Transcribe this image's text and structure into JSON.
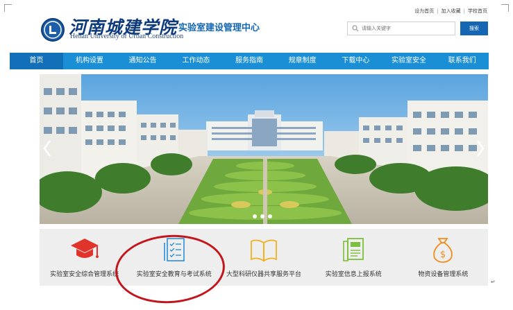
{
  "header": {
    "logo_cn": "河南城建学院",
    "logo_en": "Henan University of Urban Construction",
    "site_title": "实验室建设管理中心",
    "top_links": [
      "设为首页",
      "加入收藏",
      "学校首页"
    ],
    "search": {
      "placeholder": "请输入关键字",
      "button_label": "搜索"
    }
  },
  "nav": {
    "items": [
      "首页",
      "机构设置",
      "通知公告",
      "工作动态",
      "服务指南",
      "规章制度",
      "下载中心",
      "实验室安全",
      "联系我们"
    ],
    "active_index": 0
  },
  "banner": {
    "slide_count": 3,
    "active_slide": 0
  },
  "systems": [
    {
      "label": "实验室安全综合管理系统",
      "icon": "graduation-cap-icon"
    },
    {
      "label": "实验室安全教育与考试系统",
      "icon": "checklist-document-icon"
    },
    {
      "label": "大型科研仪器共享服务平台",
      "icon": "open-book-icon"
    },
    {
      "label": "实验室信息上报系统",
      "icon": "report-document-icon"
    },
    {
      "label": "物资设备管理系统",
      "icon": "money-bag-icon"
    }
  ],
  "colors": {
    "brand_blue": "#1567b3",
    "nav_blue": "#1b8fd6",
    "annotation_red": "#c2161c",
    "cap_red": "#e0332a",
    "icon_blue": "#2a8fd8",
    "icon_yellow": "#f2b01e",
    "icon_green": "#7bbf3a",
    "icon_orange": "#f08c1c"
  },
  "annotation": {
    "type": "red-ellipse",
    "highlights_system_index": 1
  }
}
